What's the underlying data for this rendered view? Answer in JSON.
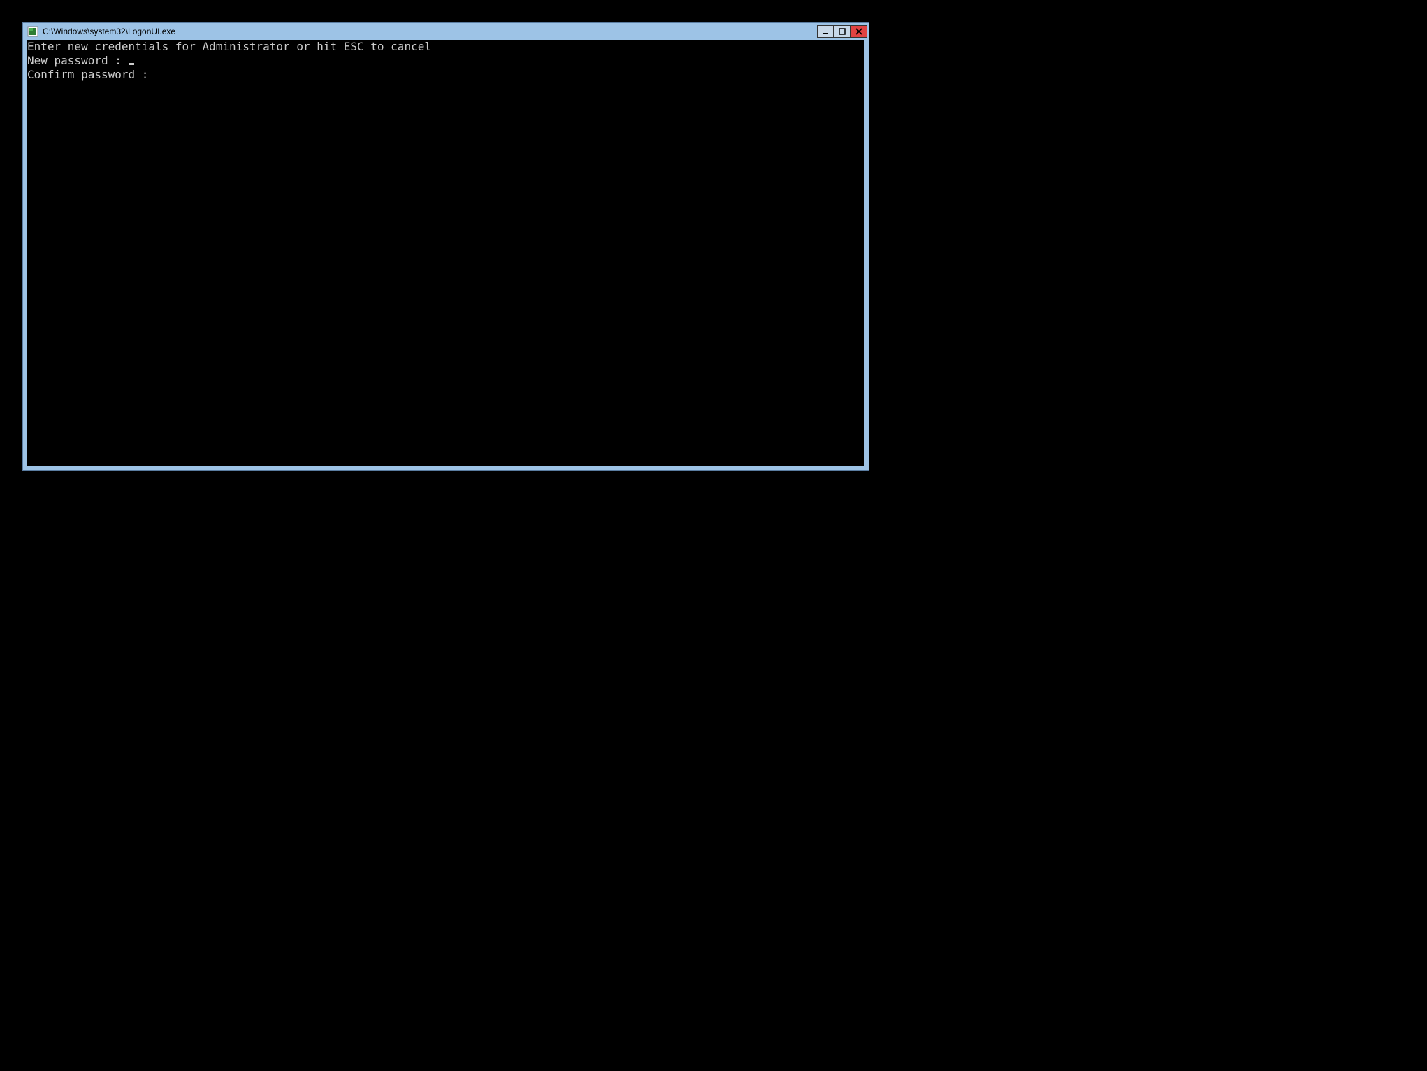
{
  "window": {
    "title": "C:\\Windows\\system32\\LogonUI.exe"
  },
  "console": {
    "line1": "Enter new credentials for Administrator or hit ESC to cancel",
    "line2_label": "New password : ",
    "line3_label": "Confirm password : "
  }
}
